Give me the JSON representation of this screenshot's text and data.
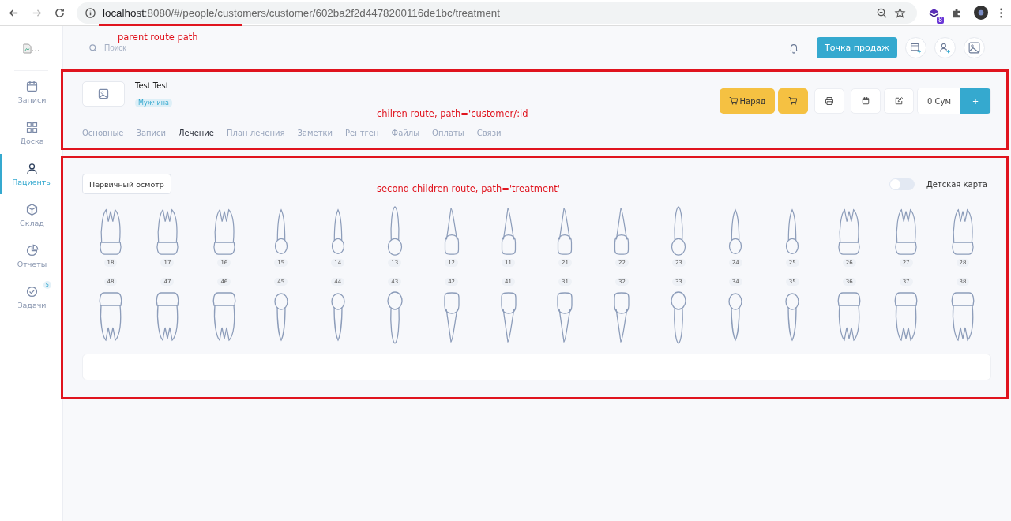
{
  "browser": {
    "url_host": "localhost",
    "url_path": ":8080/#/people/customers/customer/602ba2f2d4478200116de1bc/treatment",
    "extension_badge": "8"
  },
  "annotations": [
    "parent route path",
    "chilren route, path='customer/:id",
    "second children route, path='treatment'"
  ],
  "sidebar": {
    "logo_alt": "...",
    "items": [
      {
        "label": "Записи",
        "selected": false
      },
      {
        "label": "Доска",
        "selected": false
      },
      {
        "label": "Пациенты",
        "selected": true
      },
      {
        "label": "Склад",
        "selected": false
      },
      {
        "label": "Отчеты",
        "selected": false
      },
      {
        "label": "Задачи",
        "selected": false,
        "badge": "5"
      }
    ]
  },
  "header": {
    "search_placeholder": "Поиск",
    "pos_button": "Точка продаж"
  },
  "patient": {
    "name": "Test Test",
    "gender": "Мужчина",
    "order_button": "Наряд",
    "balance": "0 Сум",
    "add_button": "+"
  },
  "tabs": [
    {
      "label": "Основные",
      "selected": false
    },
    {
      "label": "Записи",
      "selected": false
    },
    {
      "label": "Лечение",
      "selected": true
    },
    {
      "label": "План лечения",
      "selected": false
    },
    {
      "label": "Заметки",
      "selected": false
    },
    {
      "label": "Рентген",
      "selected": false
    },
    {
      "label": "Файлы",
      "selected": false
    },
    {
      "label": "Оплаты",
      "selected": false
    },
    {
      "label": "Связи",
      "selected": false
    }
  ],
  "treatment": {
    "exam_button": "Первичный осмотр",
    "child_chart": {
      "label": "Детская карта",
      "on": false
    },
    "upper_teeth": [
      {
        "number": "18",
        "kind": "molar"
      },
      {
        "number": "17",
        "kind": "molar"
      },
      {
        "number": "16",
        "kind": "molar"
      },
      {
        "number": "15",
        "kind": "premolar"
      },
      {
        "number": "14",
        "kind": "premolar"
      },
      {
        "number": "13",
        "kind": "canine"
      },
      {
        "number": "12",
        "kind": "incisor"
      },
      {
        "number": "11",
        "kind": "incisor"
      },
      {
        "number": "21",
        "kind": "incisor"
      },
      {
        "number": "22",
        "kind": "incisor"
      },
      {
        "number": "23",
        "kind": "canine"
      },
      {
        "number": "24",
        "kind": "premolar"
      },
      {
        "number": "25",
        "kind": "premolar"
      },
      {
        "number": "26",
        "kind": "molar"
      },
      {
        "number": "27",
        "kind": "molar"
      },
      {
        "number": "28",
        "kind": "molar"
      }
    ],
    "lower_teeth": [
      {
        "number": "48",
        "kind": "molar"
      },
      {
        "number": "47",
        "kind": "molar"
      },
      {
        "number": "46",
        "kind": "molar"
      },
      {
        "number": "45",
        "kind": "premolar"
      },
      {
        "number": "44",
        "kind": "premolar"
      },
      {
        "number": "43",
        "kind": "canine"
      },
      {
        "number": "42",
        "kind": "incisor"
      },
      {
        "number": "41",
        "kind": "incisor"
      },
      {
        "number": "31",
        "kind": "incisor"
      },
      {
        "number": "32",
        "kind": "incisor"
      },
      {
        "number": "33",
        "kind": "canine"
      },
      {
        "number": "34",
        "kind": "premolar"
      },
      {
        "number": "35",
        "kind": "premolar"
      },
      {
        "number": "36",
        "kind": "molar"
      },
      {
        "number": "37",
        "kind": "molar"
      },
      {
        "number": "38",
        "kind": "molar"
      }
    ]
  }
}
